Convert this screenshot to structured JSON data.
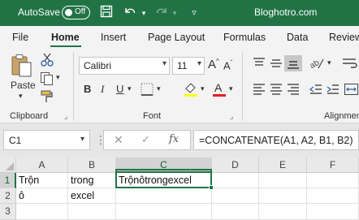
{
  "titlebar": {
    "autosave_label": "AutoSave",
    "autosave_state": "Off",
    "document_title": "Bloghotro.com"
  },
  "tabs": [
    {
      "label": "File",
      "active": false
    },
    {
      "label": "Home",
      "active": true
    },
    {
      "label": "Insert",
      "active": false
    },
    {
      "label": "Page Layout",
      "active": false
    },
    {
      "label": "Formulas",
      "active": false
    },
    {
      "label": "Data",
      "active": false
    },
    {
      "label": "Review",
      "active": false
    }
  ],
  "ribbon": {
    "clipboard": {
      "label": "Clipboard",
      "paste_label": "Paste"
    },
    "font": {
      "label": "Font",
      "font_name": "Calibri",
      "font_size": "11",
      "bold": "B",
      "italic": "I",
      "underline": "U",
      "grow": "A",
      "shrink": "A"
    },
    "alignment": {
      "label": "Alignment"
    }
  },
  "formula_bar": {
    "name_box": "C1",
    "cancel_icon": "close-icon",
    "enter_icon": "check-icon",
    "fx_label": "fx",
    "formula": "=CONCATENATE(A1, A2, B1, B2)"
  },
  "grid": {
    "columns": [
      "A",
      "B",
      "C",
      "D",
      "E",
      "F"
    ],
    "rows": [
      "1",
      "2",
      "3"
    ],
    "selected_column": "C",
    "selected_row": "1",
    "cells": {
      "A1": "Trộn",
      "B1": "trong",
      "C1": "Trộnôtrongexcel",
      "A2": "ô",
      "B2": "excel"
    }
  },
  "colors": {
    "accent": "#217346",
    "fill_color_swatch": "#ffff00",
    "font_color_swatch": "#e02020"
  }
}
